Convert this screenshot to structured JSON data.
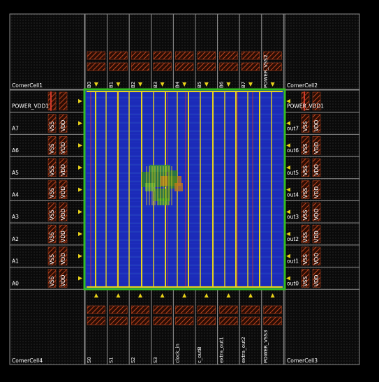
{
  "corners": {
    "top_left": "CornerCell1",
    "top_right": "CornerCell2",
    "bottom_left": "CornerCell4",
    "bottom_right": "CornerCell3"
  },
  "pads": {
    "top": [
      "B0",
      "B1",
      "B2",
      "B3",
      "B4",
      "B5",
      "B6",
      "B7",
      "POWER_VSS2"
    ],
    "bottom": [
      "S0",
      "S1",
      "S2",
      "S3",
      "clock_in",
      "c_outB",
      "extra_out1",
      "extra_out2",
      "POWER_VSS3"
    ],
    "left": [
      "POWER_VDD1",
      "A7",
      "A6",
      "A5",
      "A4",
      "A3",
      "A2",
      "A1",
      "A0"
    ],
    "right": [
      "POWER_VDD1",
      "out7",
      "out6",
      "out5",
      "out4",
      "out3",
      "out2",
      "out1",
      "out0"
    ]
  },
  "supply_labels": {
    "vss": "VSS",
    "vdd": "VDD"
  },
  "colors": {
    "background": "#000000",
    "outline": "#8a8a8a",
    "core_fill": "#1b2bb8",
    "core_border": "#33bb22",
    "power_strap": "#e8d21a",
    "signal_route": "#d23a2a",
    "hatch": "#a0341a",
    "text": "#ffffff"
  }
}
